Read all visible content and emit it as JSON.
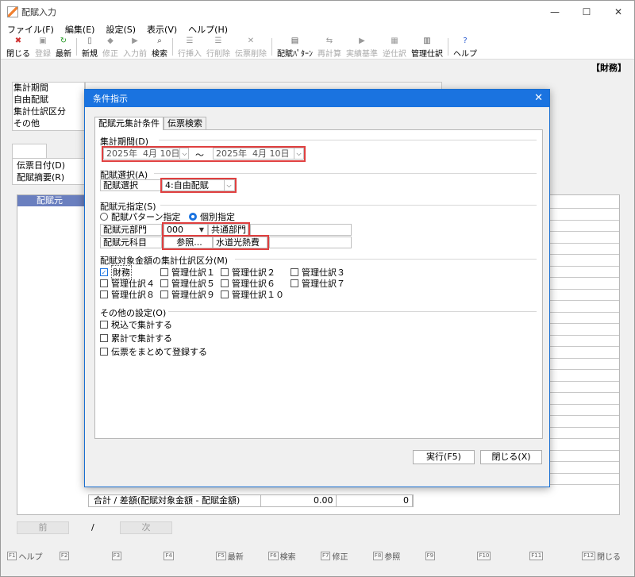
{
  "window": {
    "title": "配賦入力",
    "minimize": "—",
    "maximize": "☐",
    "close": "✕"
  },
  "menu": [
    "ファイル(F)",
    "編集(E)",
    "設定(S)",
    "表示(V)",
    "ヘルプ(H)"
  ],
  "toolbar": [
    {
      "label": "閉じる",
      "icon": "✖",
      "color": "#d03030",
      "enabled": true
    },
    {
      "label": "登録",
      "icon": "▣",
      "color": "#999",
      "enabled": false
    },
    {
      "label": "最新",
      "icon": "↻",
      "color": "#2a9a2a",
      "enabled": true
    },
    {
      "label": "新規",
      "icon": "▯",
      "color": "#666",
      "enabled": true
    },
    {
      "label": "修正",
      "icon": "◆",
      "color": "#999",
      "enabled": false
    },
    {
      "label": "入力前",
      "icon": "▶",
      "color": "#999",
      "enabled": false
    },
    {
      "label": "検索",
      "icon": "⌕",
      "color": "#333",
      "enabled": true
    },
    {
      "label": "行挿入",
      "icon": "☰",
      "color": "#999",
      "enabled": false
    },
    {
      "label": "行削除",
      "icon": "☰",
      "color": "#999",
      "enabled": false
    },
    {
      "label": "伝票削除",
      "icon": "✕",
      "color": "#999",
      "enabled": false
    },
    {
      "label": "配賦ﾊﾟﾀｰﾝ",
      "icon": "▤",
      "color": "#555",
      "enabled": true
    },
    {
      "label": "再計算",
      "icon": "⇆",
      "color": "#999",
      "enabled": false
    },
    {
      "label": "実績基準",
      "icon": "▶",
      "color": "#999",
      "enabled": false
    },
    {
      "label": "逆仕訳",
      "icon": "▦",
      "color": "#999",
      "enabled": false
    },
    {
      "label": "管理仕訳",
      "icon": "▥",
      "color": "#555",
      "enabled": true
    },
    {
      "label": "ヘルプ",
      "icon": "?",
      "color": "#2a5ad0",
      "enabled": true
    }
  ],
  "tag": "【財務】",
  "bg_labels": {
    "period": "集計期間",
    "free": "自由配賦",
    "kubun": "集計仕訳区分",
    "other": "その他",
    "date": "伝票日付(D)",
    "summary": "配賦摘要(R)",
    "grid_head": "配賦元"
  },
  "totals": {
    "label": "合計 / 差額(配賦対象金額 - 配賦金額)",
    "amount": "0.00",
    "diff": "0"
  },
  "nav": {
    "prev": "前",
    "slash": "/",
    "next": "次"
  },
  "fkeys": [
    {
      "key": "F1",
      "label": "ヘルプ"
    },
    {
      "key": "F2",
      "label": ""
    },
    {
      "key": "F3",
      "label": ""
    },
    {
      "key": "F4",
      "label": ""
    },
    {
      "key": "F5",
      "label": "最新"
    },
    {
      "key": "F6",
      "label": "検索"
    },
    {
      "key": "F7",
      "label": "修正"
    },
    {
      "key": "F8",
      "label": "参照"
    },
    {
      "key": "F9",
      "label": ""
    },
    {
      "key": "F10",
      "label": ""
    },
    {
      "key": "F11",
      "label": ""
    },
    {
      "key": "F12",
      "label": "閉じる"
    }
  ],
  "dialog": {
    "title": "条件指示",
    "close": "✕",
    "tabs": [
      "配賦元集計条件",
      "伝票検索"
    ],
    "period": {
      "label": "集計期間(D)",
      "from_year": "2025年",
      "from_md": "4月 10日",
      "to_year": "2025年",
      "to_md": "4月 10日",
      "tilde": "～",
      "drop": "⌵"
    },
    "haifu": {
      "label": "配賦選択(A)",
      "field": "配賦選択",
      "value": "4:自由配賦",
      "drop": "⌵"
    },
    "source": {
      "label": "配賦元指定(S)",
      "radio_pattern": "配賦パターン指定",
      "radio_individual": "個別指定",
      "dept_label": "配賦元部門",
      "dept_code": "000",
      "dept_drop": "▼",
      "dept_name": "共通部門",
      "acct_label": "配賦元科目",
      "acct_btn": "参照...",
      "acct_name": "水道光熱費"
    },
    "kubun": {
      "label": "配賦対象金額の集計仕訳区分(M)",
      "items": [
        "財務",
        "管理仕訳１",
        "管理仕訳２",
        "管理仕訳３",
        "管理仕訳４",
        "管理仕訳５",
        "管理仕訳６",
        "管理仕訳７",
        "管理仕訳８",
        "管理仕訳９",
        "管理仕訳１０"
      ]
    },
    "other": {
      "label": "その他の設定(O)",
      "items": [
        "税込で集計する",
        "累計で集計する",
        "伝票をまとめて登録する"
      ]
    },
    "run": "実行(F5)",
    "close_btn": "閉じる(X)"
  }
}
